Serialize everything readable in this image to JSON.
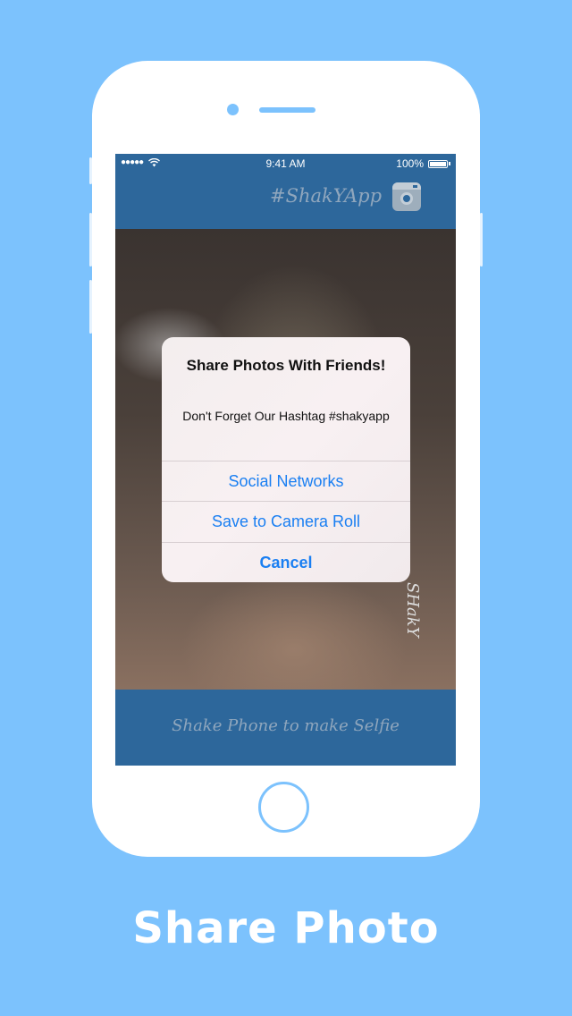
{
  "status_bar": {
    "signal": "●●●●●",
    "time": "9:41 AM",
    "battery": "100%"
  },
  "navbar": {
    "hashtag": "#ShakYApp",
    "instagram_icon": "instagram-icon"
  },
  "photo": {
    "signature": "SHakY"
  },
  "alert": {
    "title": "Share Photos With Friends!",
    "message": "Don't Forget Our Hashtag #shakyapp",
    "buttons": [
      {
        "label": "Social Networks"
      },
      {
        "label": "Save to Camera Roll"
      },
      {
        "label": "Cancel"
      }
    ]
  },
  "bottom_bar": {
    "label": "Shake Phone to make Selfie"
  },
  "caption": "Share Photo",
  "colors": {
    "background": "#7cc2fd",
    "app_bar": "#2d679b",
    "alert_action": "#1a7ff2"
  }
}
